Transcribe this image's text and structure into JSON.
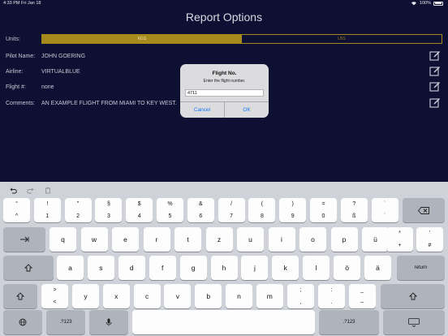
{
  "status_bar": {
    "time_date": "4:33 PM  Fri Jan 18",
    "battery": "100%"
  },
  "title": "Report Options",
  "form": {
    "units_label": "Units:",
    "units_options": [
      "KGS",
      "LBS"
    ],
    "units_selected": "KGS",
    "pilot_label": "Pilot Name:",
    "pilot_value": "JOHN GOERING",
    "airline_label": "Airline:",
    "airline_value": "VIRTUALBLUE",
    "flight_label": "Flight #:",
    "flight_value": "none",
    "comments_label": "Comments:",
    "comments_value": "AN EXAMPLE FLIGHT FROM MIAMI TO KEY WEST."
  },
  "dialog": {
    "title": "Flight No.",
    "message": "Enter the flight number.",
    "input_value": "4711",
    "cancel_label": "Cancel",
    "ok_label": "OK"
  },
  "keyboard": {
    "row1": [
      {
        "top": "°",
        "bot": "^"
      },
      {
        "top": "!",
        "bot": "1"
      },
      {
        "top": "\"",
        "bot": "2"
      },
      {
        "top": "§",
        "bot": "3"
      },
      {
        "top": "$",
        "bot": "4"
      },
      {
        "top": "%",
        "bot": "5"
      },
      {
        "top": "&",
        "bot": "6"
      },
      {
        "top": "/",
        "bot": "7"
      },
      {
        "top": "(",
        "bot": "8"
      },
      {
        "top": ")",
        "bot": "9"
      },
      {
        "top": "=",
        "bot": "0"
      },
      {
        "top": "?",
        "bot": "ß"
      },
      {
        "top": "`",
        "bot": "´"
      }
    ],
    "row2": [
      "q",
      "w",
      "e",
      "r",
      "t",
      "z",
      "u",
      "i",
      "o",
      "p",
      "ü"
    ],
    "row2_extra": [
      {
        "top": "*",
        "bot": "+"
      },
      {
        "top": "'",
        "bot": "#"
      }
    ],
    "row3": [
      "a",
      "s",
      "d",
      "f",
      "g",
      "h",
      "j",
      "k",
      "l",
      "ö",
      "ä"
    ],
    "row3_return": "return",
    "row4_first": {
      "top": ">",
      "bot": "<"
    },
    "row4": [
      "y",
      "x",
      "c",
      "v",
      "b",
      "n",
      "m"
    ],
    "row4_extra": [
      {
        "top": ";",
        "bot": ","
      },
      {
        "top": ":",
        "bot": "."
      },
      {
        "top": "_",
        "bot": "–"
      }
    ],
    "numbers_label": ".?123"
  }
}
